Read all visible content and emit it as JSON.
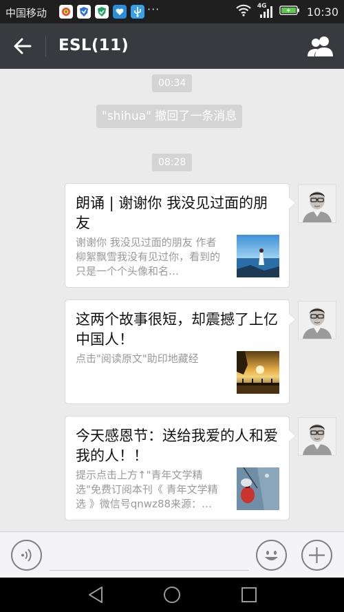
{
  "status_bar": {
    "carrier": "中国移动",
    "dots": "···",
    "network_type": "4G",
    "time": "10:30",
    "icons": [
      "photo-app-icon",
      "shield-app-icon",
      "shield-app-icon",
      "heart-app-icon",
      "usb-icon",
      "wifi-icon",
      "signal-icon",
      "battery-charging-icon"
    ]
  },
  "title_bar": {
    "title": "ESL(11)",
    "icons": [
      "back-arrow-icon",
      "group-members-icon"
    ]
  },
  "messages": {
    "time_1": "00:34",
    "recall_notice": "\"shihua\" 撤回了一条消息",
    "time_2": "08:28",
    "articles": [
      {
        "title": "朗诵 | 谢谢你 我没见过面的朋友",
        "description": "谢谢你 我没见过面的朋友   作者 柳絮飘雪我没有见过你，看到的只是一个个头像和名…",
        "thumbnail": "woman-by-sea-image"
      },
      {
        "title": "这两个故事很短，却震撼了上亿中国人！",
        "description": "点击\"阅读原文\"助印地藏经",
        "thumbnail": "sunset-lake-image"
      },
      {
        "title": "今天感恩节：送给我爱的人和爱我的人！！",
        "description": "提示点击上方↑\"青年文学精选\"免费订阅本刊《 青年文学精选 》微信号qnwz88来源：…",
        "thumbnail": "lanterns-image"
      }
    ],
    "sender_avatar": "man-with-glasses-avatar"
  },
  "input_bar": {
    "icons": [
      "voice-icon",
      "emoji-icon",
      "plus-icon"
    ],
    "text_value": ""
  },
  "nav_bar": {
    "icons": [
      "back-triangle-icon",
      "home-circle-icon",
      "recents-square-icon"
    ]
  },
  "colors": {
    "title_bar": "#393a3f",
    "chat_background": "#ebebeb",
    "time_chip": "#d4d4d4",
    "card_background": "#ffffff",
    "card_description": "#999999"
  }
}
